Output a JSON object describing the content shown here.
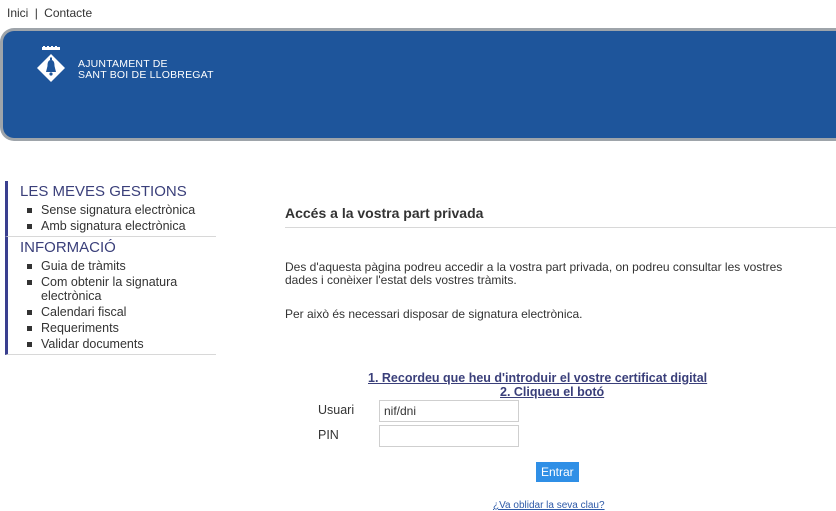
{
  "toplinks": {
    "home": "Inici",
    "separator": "|",
    "contact": "Contacte"
  },
  "header": {
    "logo_line1": "Ajuntament de",
    "logo_line2": "Sant Boi de Llobregat",
    "bg_color": "#1e559b"
  },
  "sidebar": {
    "gestions_title": "LES MEVES GESTIONS",
    "gestions_items": [
      "Sense signatura electrònica",
      "Amb signatura electrònica"
    ],
    "info_title": "INFORMACIÓ",
    "info_items": [
      "Guia de tràmits",
      "Com obtenir la signatura electrònica",
      "Calendari fiscal",
      "Requeriments",
      "Validar documents"
    ]
  },
  "main": {
    "title": "Accés a la vostra part privada",
    "para1": "Des d'aquesta pàgina podreu accedir a la vostra part privada, on podreu consultar les vostres dades i conèixer l'estat dels vostres tràmits.",
    "para2": "Per això és necessari disposar de signatura electrònica.",
    "step1": "1. Recordeu que heu d'introduir el vostre certificat digital",
    "step2": "2. Cliqueu el botó",
    "user_label": "Usuari",
    "user_value": "nif/dni",
    "pin_label": "PIN",
    "pin_value": "",
    "submit": "Entrar",
    "forgot": "¿Va oblidar la seva clau?"
  }
}
